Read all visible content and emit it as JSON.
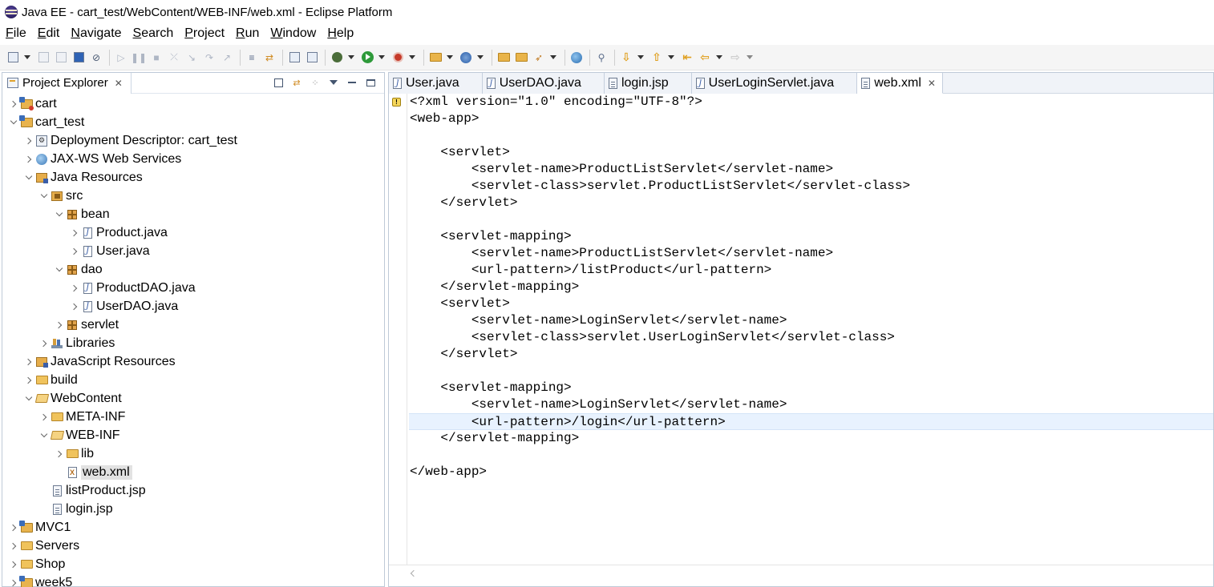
{
  "window": {
    "title": "Java EE - cart_test/WebContent/WEB-INF/web.xml - Eclipse Platform"
  },
  "menu": [
    {
      "mn": "F",
      "rest": "ile"
    },
    {
      "mn": "E",
      "rest": "dit"
    },
    {
      "mn": "N",
      "rest": "avigate"
    },
    {
      "mn": "S",
      "rest": "earch"
    },
    {
      "mn": "P",
      "rest": "roject"
    },
    {
      "mn": "R",
      "rest": "un"
    },
    {
      "mn": "W",
      "rest": "indow"
    },
    {
      "mn": "H",
      "rest": "elp"
    }
  ],
  "project_explorer": {
    "title": "Project Explorer",
    "tree": [
      {
        "label": "cart",
        "level": 0,
        "state": "collapsed",
        "icon": "project-error-icon"
      },
      {
        "label": "cart_test",
        "level": 0,
        "state": "expanded",
        "icon": "project-icon"
      },
      {
        "label": "Deployment Descriptor: cart_test",
        "level": 1,
        "state": "collapsed",
        "icon": "deployment-descriptor-icon"
      },
      {
        "label": "JAX-WS Web Services",
        "level": 1,
        "state": "collapsed",
        "icon": "web-services-icon"
      },
      {
        "label": "Java Resources",
        "level": 1,
        "state": "expanded",
        "icon": "java-resources-icon"
      },
      {
        "label": "src",
        "level": 2,
        "state": "expanded",
        "icon": "source-folder-icon"
      },
      {
        "label": "bean",
        "level": 3,
        "state": "expanded",
        "icon": "package-icon"
      },
      {
        "label": "Product.java",
        "level": 4,
        "state": "collapsed",
        "icon": "java-file-icon"
      },
      {
        "label": "User.java",
        "level": 4,
        "state": "collapsed",
        "icon": "java-file-icon"
      },
      {
        "label": "dao",
        "level": 3,
        "state": "expanded",
        "icon": "package-icon"
      },
      {
        "label": "ProductDAO.java",
        "level": 4,
        "state": "collapsed",
        "icon": "java-file-icon"
      },
      {
        "label": "UserDAO.java",
        "level": 4,
        "state": "collapsed",
        "icon": "java-file-icon"
      },
      {
        "label": "servlet",
        "level": 3,
        "state": "collapsed",
        "icon": "package-icon"
      },
      {
        "label": "Libraries",
        "level": 2,
        "state": "collapsed",
        "icon": "libraries-icon"
      },
      {
        "label": "JavaScript Resources",
        "level": 1,
        "state": "collapsed",
        "icon": "javascript-resources-icon"
      },
      {
        "label": "build",
        "level": 1,
        "state": "collapsed",
        "icon": "folder-icon"
      },
      {
        "label": "WebContent",
        "level": 1,
        "state": "expanded",
        "icon": "folder-open-icon"
      },
      {
        "label": "META-INF",
        "level": 2,
        "state": "collapsed",
        "icon": "folder-icon"
      },
      {
        "label": "WEB-INF",
        "level": 2,
        "state": "expanded",
        "icon": "folder-open-icon"
      },
      {
        "label": "lib",
        "level": 3,
        "state": "collapsed",
        "icon": "folder-icon"
      },
      {
        "label": "web.xml",
        "level": 3,
        "state": "leaf",
        "icon": "xml-file-icon",
        "selected": true
      },
      {
        "label": "listProduct.jsp",
        "level": 2,
        "state": "leaf",
        "icon": "jsp-file-icon"
      },
      {
        "label": "login.jsp",
        "level": 2,
        "state": "leaf",
        "icon": "jsp-file-icon"
      },
      {
        "label": "MVC1",
        "level": 0,
        "state": "collapsed",
        "icon": "project-icon"
      },
      {
        "label": "Servers",
        "level": 0,
        "state": "collapsed",
        "icon": "folder-icon"
      },
      {
        "label": "Shop",
        "level": 0,
        "state": "collapsed",
        "icon": "folder-icon"
      },
      {
        "label": "week5",
        "level": 0,
        "state": "collapsed",
        "icon": "project-icon"
      }
    ]
  },
  "editor": {
    "tabs": [
      {
        "label": "User.java",
        "icon": "java-file-icon",
        "active": false
      },
      {
        "label": "UserDAO.java",
        "icon": "java-file-icon",
        "active": false
      },
      {
        "label": "login.jsp",
        "icon": "jsp-file-icon",
        "active": false
      },
      {
        "label": "UserLoginServlet.java",
        "icon": "java-file-icon",
        "active": false
      },
      {
        "label": "web.xml",
        "icon": "xml-file-icon",
        "active": true
      }
    ],
    "lines": [
      "<?xml version=\"1.0\" encoding=\"UTF-8\"?>",
      "<web-app>",
      "",
      "    <servlet>",
      "        <servlet-name>ProductListServlet</servlet-name>",
      "        <servlet-class>servlet.ProductListServlet</servlet-class>",
      "    </servlet>",
      "",
      "    <servlet-mapping>",
      "        <servlet-name>ProductListServlet</servlet-name>",
      "        <url-pattern>/listProduct</url-pattern>",
      "    </servlet-mapping>",
      "    <servlet>",
      "        <servlet-name>LoginServlet</servlet-name>",
      "        <servlet-class>servlet.UserLoginServlet</servlet-class>",
      "    </servlet>",
      "",
      "    <servlet-mapping>",
      "        <servlet-name>LoginServlet</servlet-name>",
      "        <url-pattern>/login</url-pattern>",
      "    </servlet-mapping>",
      "",
      "</web-app>"
    ],
    "current_line": 19
  }
}
